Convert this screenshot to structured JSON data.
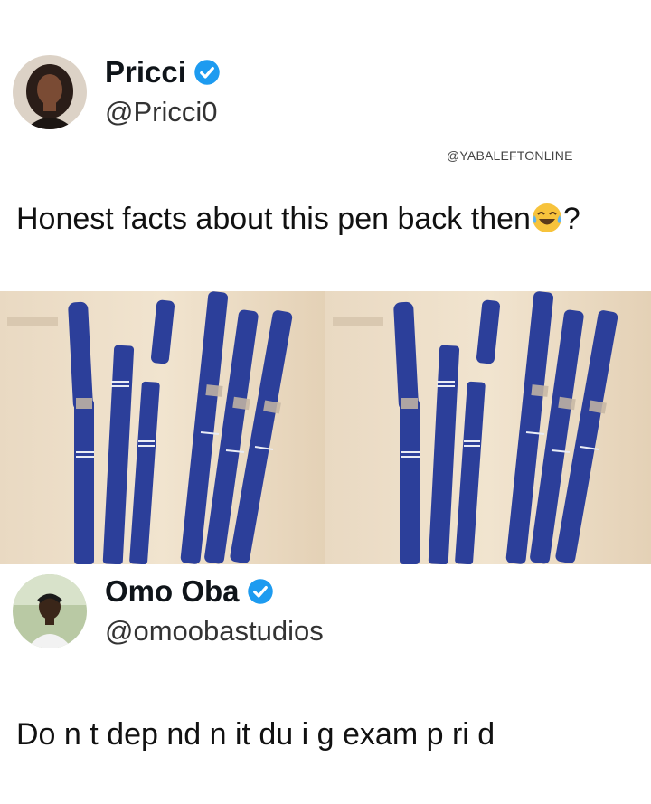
{
  "tweet1": {
    "display_name": "Pricci",
    "handle": "@Pricci0",
    "watermark": "@YABALEFTONLINE",
    "text": "Honest facts about this pen back then",
    "text_suffix": "?",
    "emoji": "face-with-tears-of-joy"
  },
  "tweet2": {
    "display_name": "Omo Oba",
    "handle": "@omoobastudios",
    "text": "Do n t dep nd  n it du i g exam p ri d"
  },
  "colors": {
    "verified": "#1d9bf0",
    "pen_blue": "#2c3f9a",
    "background": "#e8d6bd"
  }
}
